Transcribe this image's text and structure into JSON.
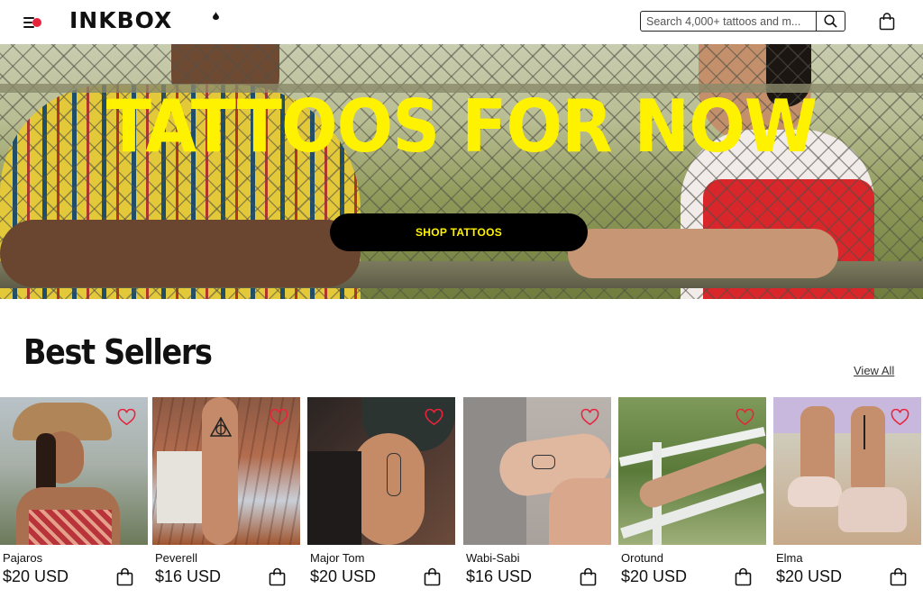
{
  "header": {
    "logo_text": "INKBOX",
    "search_placeholder": "Search 4,000+ tattoos and m...",
    "icons": {
      "menu": "menu-icon",
      "search": "search-icon",
      "cart": "shopping-bag-icon"
    },
    "accent_color": "#e8243c"
  },
  "hero": {
    "title": "TATTOOS FOR NOW",
    "cta_label": "SHOP TATTOOS",
    "title_color": "#fff200"
  },
  "best_sellers": {
    "title": "Best Sellers",
    "view_all_label": "View All",
    "products": [
      {
        "name": "Pajaros",
        "price": "$20 USD"
      },
      {
        "name": "Peverell",
        "price": "$16 USD"
      },
      {
        "name": "Major Tom",
        "price": "$20 USD"
      },
      {
        "name": "Wabi-Sabi",
        "price": "$16 USD"
      },
      {
        "name": "Orotund",
        "price": "$20 USD"
      },
      {
        "name": "Elma",
        "price": "$20 USD"
      }
    ],
    "icons": {
      "favorite": "heart-icon",
      "add_to_bag": "shopping-bag-icon"
    },
    "favorite_color": "#e8243c"
  }
}
